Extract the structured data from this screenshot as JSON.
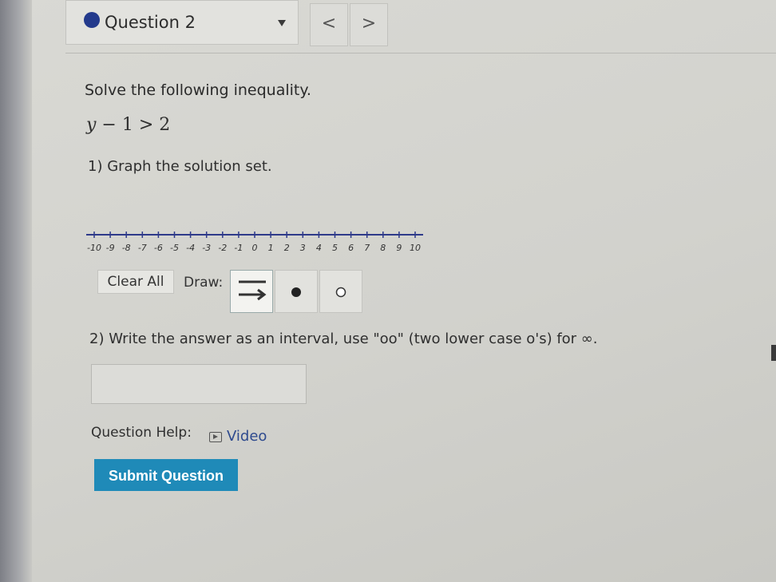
{
  "header": {
    "question_label": "Question 2",
    "prev_label": "<",
    "next_label": ">"
  },
  "problem": {
    "instruction": "Solve the following inequality.",
    "inequality": {
      "var": "y",
      "rest": " − 1 > 2"
    },
    "part1_label": "1) Graph the solution set.",
    "part2_label": "2) Write the answer as an interval, use \"oo\" (two lower case o's) for ∞."
  },
  "number_line": {
    "min": -10,
    "max": 10,
    "tick_labels": [
      "-10",
      "-9",
      "-8",
      "-7",
      "-6",
      "-5",
      "-4",
      "-3",
      "-2",
      "-1",
      "0",
      "1",
      "2",
      "3",
      "4",
      "5",
      "6",
      "7",
      "8",
      "9",
      "10"
    ]
  },
  "toolbar": {
    "clear_label": "Clear All",
    "draw_label": "Draw:",
    "tools": [
      "ray-tool-icon",
      "closed-dot-icon",
      "open-dot-icon"
    ]
  },
  "answer": {
    "value": "",
    "placeholder": ""
  },
  "help": {
    "label": "Question Help:",
    "video_label": "Video"
  },
  "submit_label": "Submit Question",
  "colors": {
    "accent": "#1f8ab8",
    "question_dot": "#233a8c",
    "link": "#2e4a8e"
  }
}
